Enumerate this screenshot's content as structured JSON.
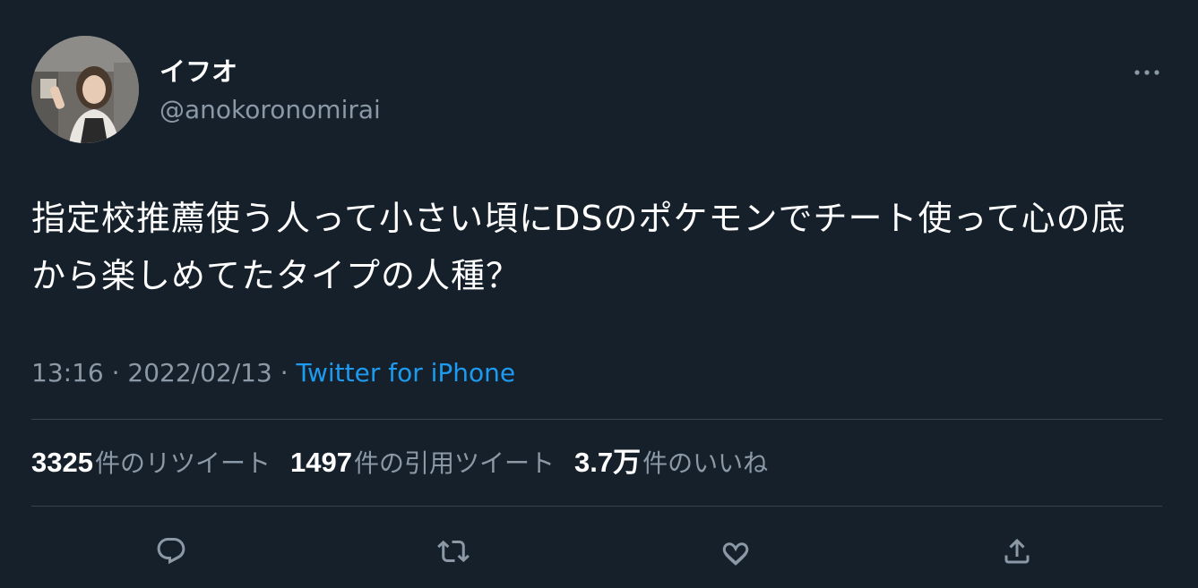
{
  "author": {
    "display_name": "イフオ",
    "handle": "@anokoronomirai"
  },
  "tweet": {
    "text": "指定校推薦使う人って小さい頃にDSのポケモンでチート使って心の底から楽しめてたタイプの人種？",
    "time": "13:16",
    "separator": " · ",
    "date": "2022/02/13",
    "source": "Twitter for iPhone"
  },
  "stats": {
    "retweets": {
      "count": "3325",
      "label": "件のリツイート"
    },
    "quotes": {
      "count": "1497",
      "label": "件の引用ツイート"
    },
    "likes": {
      "count": "3.7万",
      "label": "件のいいね"
    }
  },
  "icons": {
    "more": "more-horizontal-icon",
    "reply": "reply-icon",
    "retweet": "retweet-icon",
    "like": "heart-icon",
    "share": "share-icon"
  },
  "colors": {
    "background": "#15202b",
    "primary_text": "#ffffff",
    "secondary_text": "#8b98a5",
    "link": "#1d9bf0",
    "divider": "#38444d"
  }
}
